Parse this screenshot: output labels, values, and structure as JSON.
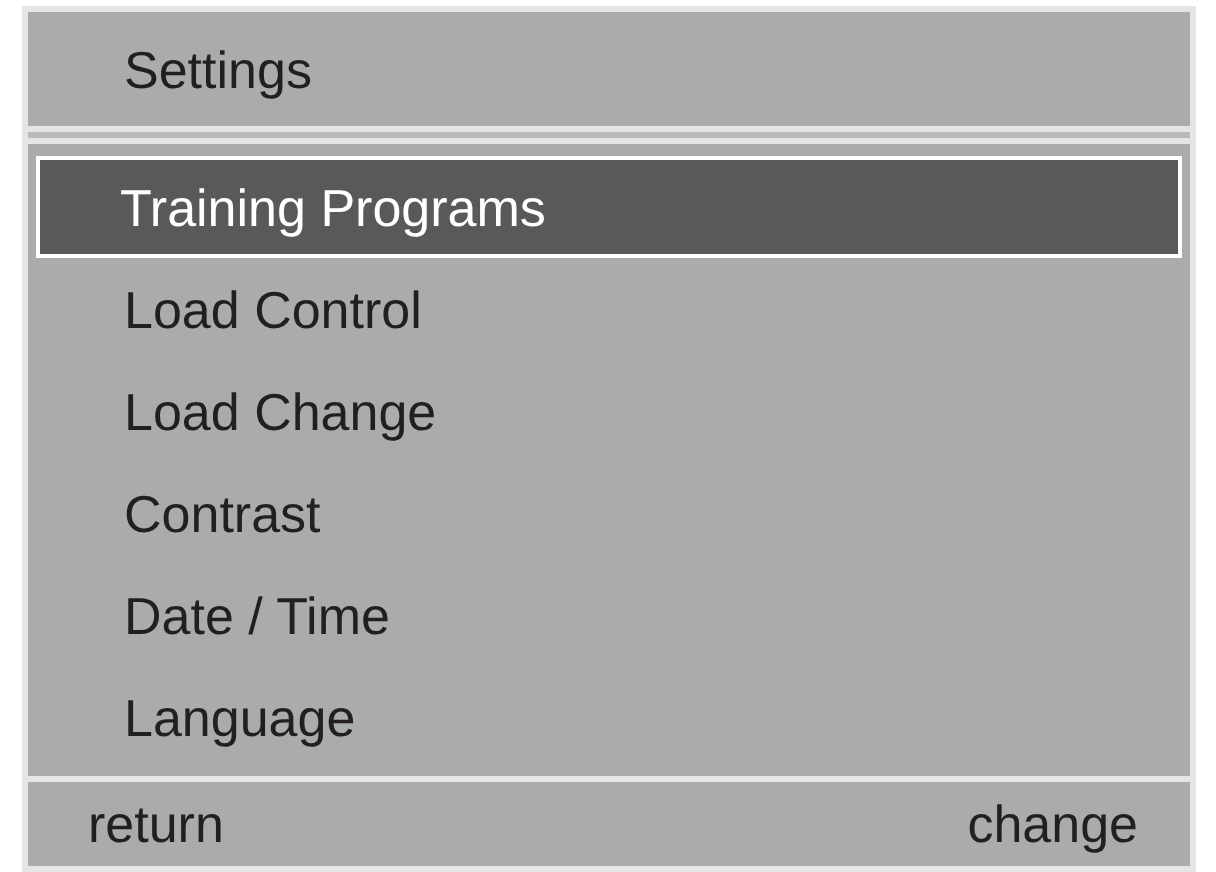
{
  "title": "Settings",
  "menu": [
    {
      "label": "Training Programs",
      "selected": true
    },
    {
      "label": "Load Control",
      "selected": false
    },
    {
      "label": "Load Change",
      "selected": false
    },
    {
      "label": "Contrast",
      "selected": false
    },
    {
      "label": "Date / Time",
      "selected": false
    },
    {
      "label": "Language",
      "selected": false
    }
  ],
  "footer": {
    "left": "return",
    "right": "change"
  }
}
